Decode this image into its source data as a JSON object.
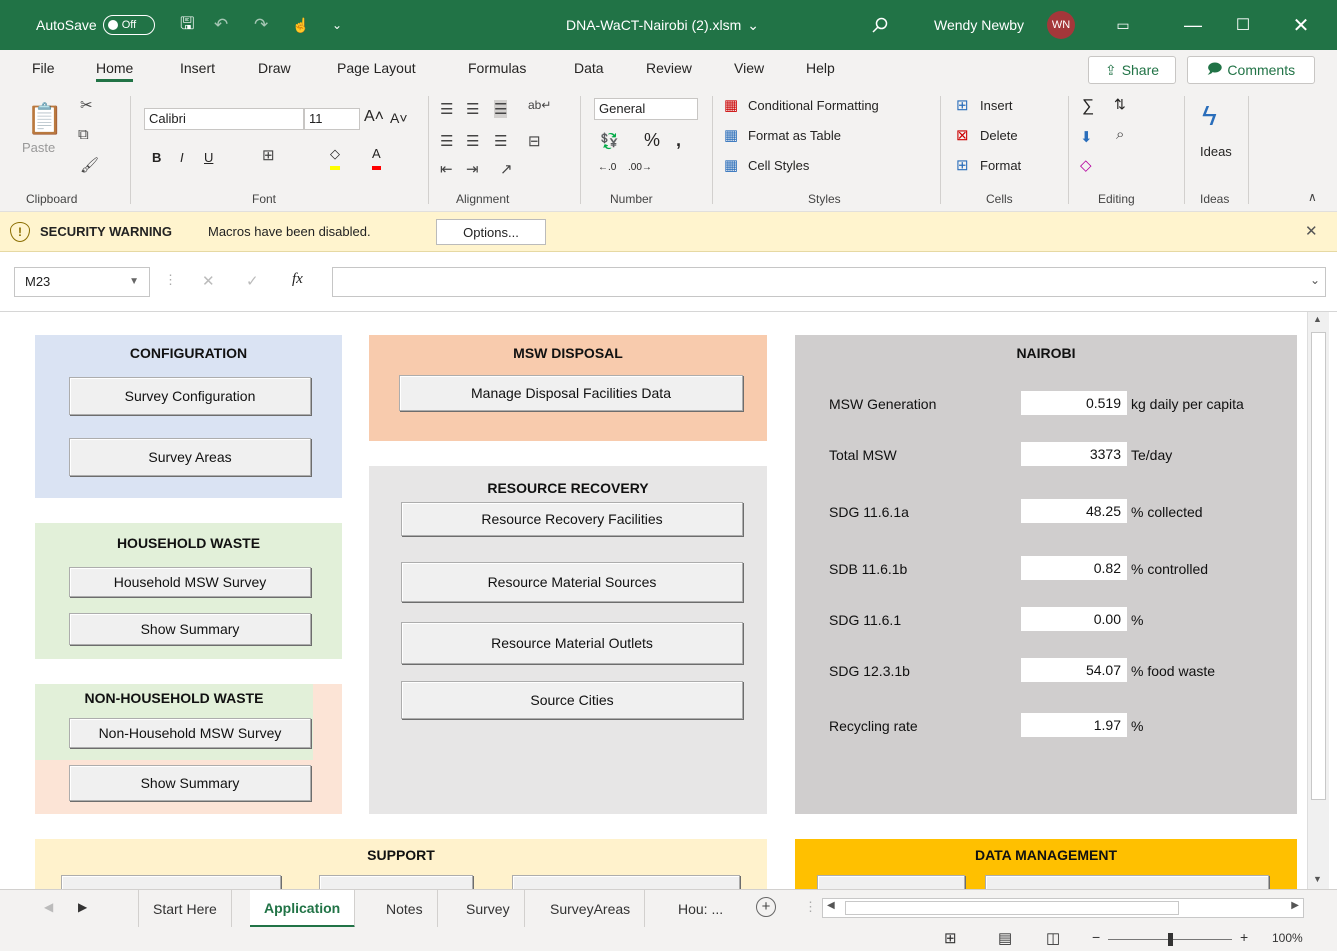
{
  "titlebar": {
    "autosave_label": "AutoSave",
    "autosave_state": "Off",
    "filename": "DNA-WaCT-Nairobi (2).xlsm",
    "filename_caret": "⌄",
    "user_name": "Wendy Newby",
    "user_initials": "WN"
  },
  "menu": {
    "tabs": [
      "File",
      "Home",
      "Insert",
      "Draw",
      "Page Layout",
      "Formulas",
      "Data",
      "Review",
      "View",
      "Help"
    ],
    "active": "Home",
    "share": "Share",
    "comments": "Comments"
  },
  "ribbon": {
    "paste": "Paste",
    "font_name": "Calibri",
    "font_size": "11",
    "number_format": "General",
    "conditional_formatting": "Conditional Formatting",
    "format_as_table": "Format as Table",
    "cell_styles": "Cell Styles",
    "insert": "Insert",
    "delete": "Delete",
    "format": "Format",
    "ideas": "Ideas",
    "groups": [
      "Clipboard",
      "Font",
      "Alignment",
      "Number",
      "Styles",
      "Cells",
      "Editing",
      "Ideas"
    ]
  },
  "security": {
    "title": "SECURITY WARNING",
    "message": "Macros have been disabled.",
    "options_button": "Options..."
  },
  "formula_bar": {
    "name_box": "M23",
    "fx": "fx",
    "formula": ""
  },
  "sheet": {
    "configuration": {
      "title": "CONFIGURATION",
      "buttons": [
        "Survey Configuration",
        "Survey Areas"
      ]
    },
    "household": {
      "title": "HOUSEHOLD WASTE",
      "buttons": [
        "Household MSW Survey",
        "Show Summary"
      ]
    },
    "non_household": {
      "title": "NON-HOUSEHOLD WASTE",
      "buttons": [
        "Non-Household MSW Survey",
        "Show Summary"
      ]
    },
    "disposal": {
      "title": "MSW DISPOSAL",
      "buttons": [
        "Manage Disposal Facilities Data"
      ]
    },
    "resource": {
      "title": "RESOURCE RECOVERY",
      "buttons": [
        "Resource Recovery Facilities",
        "Resource Material Sources",
        "Resource Material Outlets",
        "Source Cities"
      ]
    },
    "nairobi": {
      "title": "NAIROBI",
      "rows": [
        {
          "label": "MSW Generation",
          "value": "0.519",
          "unit": "kg daily per capita"
        },
        {
          "label": "Total MSW",
          "value": "3373",
          "unit": "Te/day"
        },
        {
          "label": "SDG 11.6.1a",
          "value": "48.25",
          "unit": "% collected"
        },
        {
          "label": "SDB 11.6.1b",
          "value": "0.82",
          "unit": "% controlled"
        },
        {
          "label": "SDG 11.6.1",
          "value": "0.00",
          "unit": "%"
        },
        {
          "label": "SDG 12.3.1b",
          "value": "54.07",
          "unit": "% food waste"
        },
        {
          "label": "Recycling rate",
          "value": "1.97",
          "unit": "%"
        }
      ]
    },
    "support": {
      "title": "SUPPORT"
    },
    "data_management": {
      "title": "DATA MANAGEMENT"
    }
  },
  "sheet_tabs": [
    "Start Here",
    "Application",
    "Notes",
    "Survey",
    "SurveyAreas",
    "Hou: ..."
  ],
  "active_sheet": "Application",
  "status": {
    "zoom": "100%"
  },
  "colors": {
    "excel_green": "#217346",
    "config_panel": "#dae3f3",
    "household_panel": "#e2f0d9",
    "nonhousehold_panel": "#fce4d6",
    "disposal_panel": "#f8cbad",
    "resource_panel": "#e7e6e6",
    "nairobi_panel": "#d0cece",
    "support_panel": "#fff2cc",
    "data_mgmt_panel": "#ffc000"
  }
}
